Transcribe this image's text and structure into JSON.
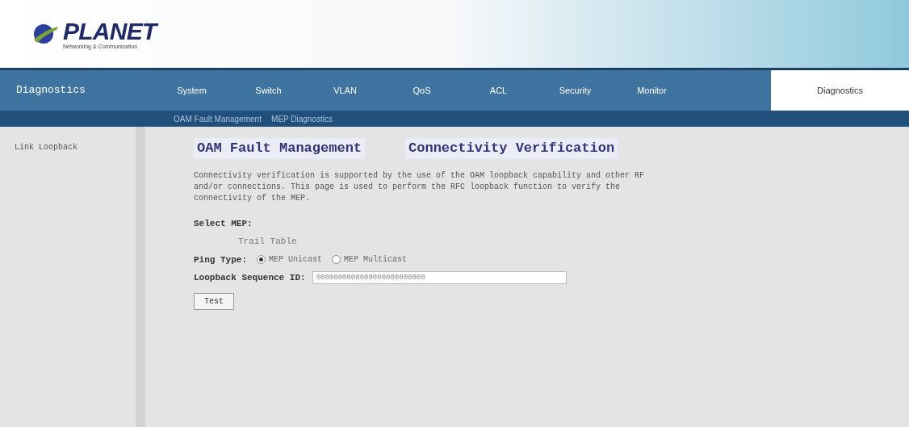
{
  "logo": {
    "text": "PLANET",
    "tagline": "Networking & Communication"
  },
  "nav": {
    "section": "Diagnostics",
    "tabs": [
      {
        "label": "System",
        "selected": false
      },
      {
        "label": "Switch",
        "selected": false
      },
      {
        "label": "VLAN",
        "selected": false
      },
      {
        "label": "QoS",
        "selected": false
      },
      {
        "label": "ACL",
        "selected": false
      },
      {
        "label": "Security",
        "selected": false
      },
      {
        "label": "Monitor",
        "selected": false
      },
      {
        "label": "Diagnostics",
        "selected": true
      }
    ]
  },
  "subnav": [
    "OAM Fault Management",
    "MEP Diagnostics"
  ],
  "sidebar": {
    "items": [
      {
        "label": "Link Loopback",
        "selected": false
      }
    ]
  },
  "page": {
    "title_parts": [
      "OAM Fault Management",
      "Connectivity Verification"
    ],
    "description": "Connectivity verification is supported by the use of the OAM loopback capability and other RF and/or connections. This page is used to perform the RFC loopback function to verify the connectivity of the MEP.",
    "select_label": "Select MEP:",
    "select_value": "Trail  Table",
    "ping_label": "Ping Type:",
    "ping_options": [
      {
        "label": "MEP Unicast",
        "selected": true
      },
      {
        "label": "MEP Multicast",
        "selected": false
      }
    ],
    "seq_label": "Loopback Sequence ID:",
    "seq_value": "0000000000000000000000000",
    "button": "Test"
  }
}
